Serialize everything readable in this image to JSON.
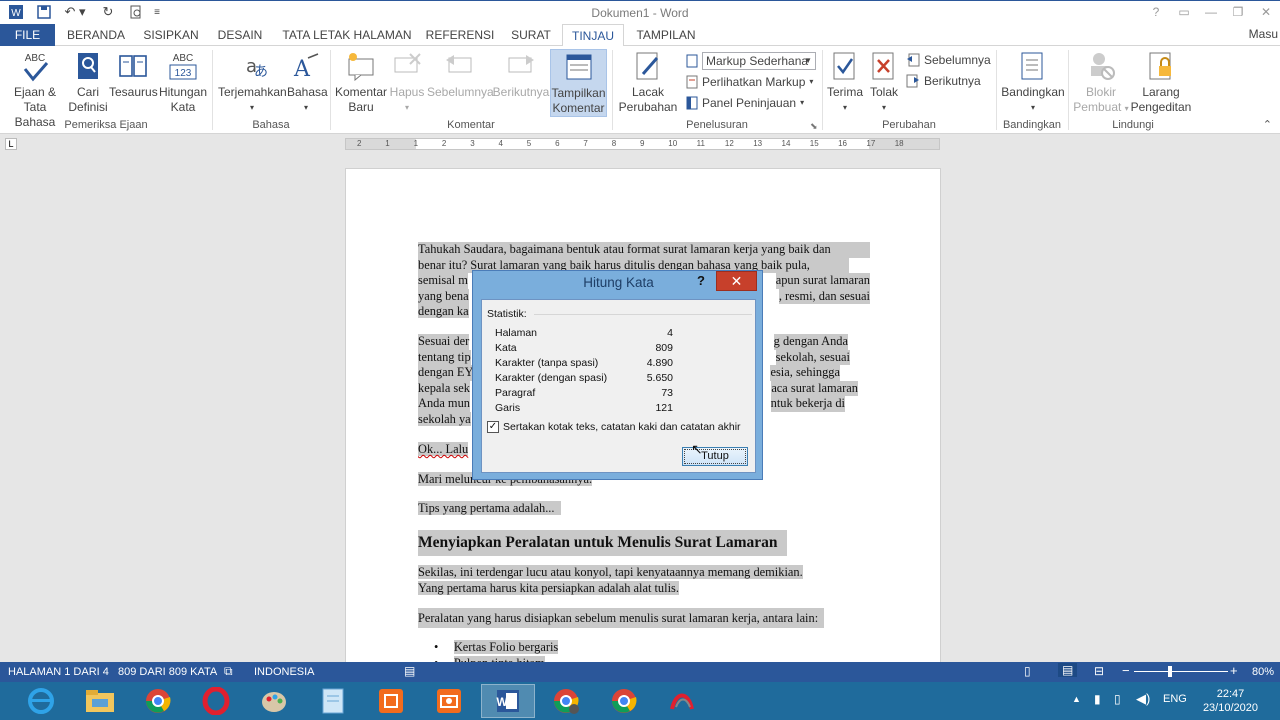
{
  "window": {
    "title": "Dokumen1 - Word",
    "user": "Masu"
  },
  "quick_access": {
    "icons": [
      "word-icon",
      "save-icon",
      "undo-icon",
      "redo-icon",
      "print-preview-icon",
      "customize-icon"
    ]
  },
  "tabs": {
    "file": "FILE",
    "items": [
      "BERANDA",
      "SISIPKAN",
      "DESAIN",
      "TATA LETAK HALAMAN",
      "REFERENSI",
      "SURAT",
      "TINJAU",
      "TAMPILAN"
    ],
    "active": "TINJAU"
  },
  "ribbon": {
    "proofing": {
      "spelling": [
        "Ejaan &",
        "Tata Bahasa"
      ],
      "research": [
        "Cari",
        "Definisi"
      ],
      "thesaurus": "Tesaurus",
      "word_count": [
        "Hitungan",
        "Kata"
      ],
      "group": "Pemeriksa Ejaan",
      "abc": "ABC",
      "abc123": "123"
    },
    "language": {
      "translate": "Terjemahkan",
      "language": "Bahasa",
      "group": "Bahasa"
    },
    "comments": {
      "new": [
        "Komentar",
        "Baru"
      ],
      "delete": "Hapus",
      "previous": "Sebelumnya",
      "next": "Berikutnya",
      "show": [
        "Tampilkan",
        "Komentar"
      ],
      "group": "Komentar"
    },
    "tracking": {
      "track": [
        "Lacak",
        "Perubahan"
      ],
      "markup_mode": "Markup Sederhana",
      "show_markup": "Perlihatkan Markup",
      "reviewing_pane": "Panel Peninjauan",
      "group": "Penelusuran"
    },
    "changes": {
      "accept": "Terima",
      "reject": "Tolak",
      "previous": "Sebelumnya",
      "next": "Berikutnya",
      "group": "Perubahan"
    },
    "compare": {
      "compare": "Bandingkan",
      "group": "Bandingkan"
    },
    "protect": {
      "block": [
        "Blokir",
        "Pembuat"
      ],
      "restrict": [
        "Larang",
        "Pengeditan"
      ],
      "group": "Lindungi"
    }
  },
  "ruler": {
    "marks": [
      "2",
      "1",
      "1",
      "2",
      "3",
      "4",
      "5",
      "6",
      "7",
      "8",
      "9",
      "10",
      "11",
      "12",
      "13",
      "14",
      "15",
      "16",
      "17",
      "18"
    ],
    "tab_selector": "L"
  },
  "document": {
    "p1": [
      "Tahukah Saudara, bagaimana bentuk atau format surat lamaran kerja yang baik dan",
      "benar itu? Surat lamaran yang baik harus ditulis dengan bahasa yang baik pula,",
      "semisal m",
      "apun surat lamaran",
      "yang bena",
      ", resmi, dan sesuai",
      "dengan ka"
    ],
    "p2": [
      "Sesuai der",
      "g dengan Anda",
      "tentang tip",
      "sekolah, sesuai",
      "dengan EY",
      "esia, sehingga",
      "kepala sek",
      "aca surat lamaran",
      "Anda mun",
      "ntuk bekerja di",
      "sekolah ya"
    ],
    "p3": "Ok... Lalu",
    "p4": "Mari meluncur ke pembahasannya.",
    "p5": "Tips yang pertama adalah...",
    "heading": "Menyiapkan Peralatan untuk Menulis Surat Lamaran",
    "p6": [
      "Sekilas, ini terdengar lucu atau konyol, tapi kenyataannya memang demikian.",
      "Yang pertama harus kita persiapkan adalah alat tulis."
    ],
    "p7": "Peralatan yang harus disiapkan sebelum menulis surat lamaran kerja, antara lain:",
    "bullets": [
      "Kertas Folio bergaris",
      "Pulpen tinta hitam"
    ]
  },
  "dialog": {
    "title": "Hitung Kata",
    "help": "?",
    "close": "✕",
    "stats_label": "Statistik:",
    "stats": [
      {
        "label": "Halaman",
        "value": "4"
      },
      {
        "label": "Kata",
        "value": "809"
      },
      {
        "label": "Karakter (tanpa spasi)",
        "value": "4.890"
      },
      {
        "label": "Karakter (dengan spasi)",
        "value": "5.650"
      },
      {
        "label": "Paragraf",
        "value": "73"
      },
      {
        "label": "Garis",
        "value": "121"
      }
    ],
    "include_checkbox": "Sertakan kotak teks, catatan kaki dan catatan akhir",
    "include_checked": true,
    "close_button": "Tutup"
  },
  "status": {
    "page": "HALAMAN 1 DARI 4",
    "words": "809 DARI 809 KATA",
    "language": "INDONESIA",
    "zoom": "80%"
  },
  "taskbar": {
    "apps": [
      "ie-icon",
      "file-explorer-icon",
      "chrome-icon",
      "opera-icon",
      "paint-icon",
      "notepad-icon",
      "screen-recorder-icon",
      "camera-app-icon",
      "word-icon",
      "chrome-profile-icon",
      "chrome-icon-2",
      "pdf-reader-icon"
    ],
    "lang": "ENG",
    "time": "22:47",
    "date": "23/10/2020"
  },
  "colors": {
    "accent": "#2b579a",
    "taskbar": "#1f6b9c",
    "dialog_frame": "#7aaedc",
    "close_red": "#c7402b"
  }
}
